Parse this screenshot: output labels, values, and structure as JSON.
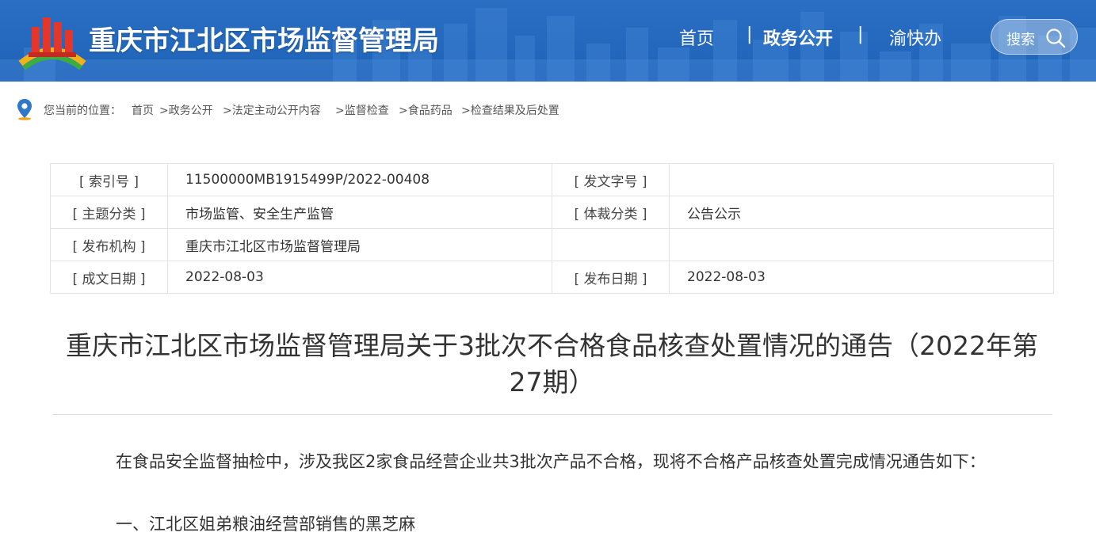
{
  "header": {
    "site_title": "重庆市江北区市场监督管理局",
    "nav": {
      "home": "首页",
      "separator": "|",
      "gov_open": "政务公开",
      "yu_kuai_ban": "渝快办"
    },
    "search_label": "搜索",
    "colors": {
      "bar": "#1f63b8",
      "text": "#ffffff"
    }
  },
  "breadcrumb": {
    "prefix": "您当前的位置：",
    "items": [
      "首页",
      ">政务公开",
      ">法定主动公开内容",
      ">监督检查",
      ">食品药品",
      ">检查结果及后处置"
    ]
  },
  "meta": {
    "rows": [
      {
        "label1": "[ 索引号 ]",
        "value1": "11500000MB1915499P/2022-00408",
        "label2": "[ 发文字号 ]",
        "value2": ""
      },
      {
        "label1": "[ 主题分类 ]",
        "value1": "市场监管、安全生产监管",
        "label2": "[ 体裁分类 ]",
        "value2": "公告公示"
      },
      {
        "label1": "[ 发布机构 ]",
        "value1": "重庆市江北区市场监督管理局",
        "label2": "",
        "value2": ""
      },
      {
        "label1": "[ 成文日期 ]",
        "value1": "2022-08-03",
        "label2": "[ 发布日期 ]",
        "value2": "2022-08-03"
      }
    ]
  },
  "article": {
    "title": "重庆市江北区市场监督管理局关于3批次不合格食品核查处置情况的通告（2022年第27期）",
    "paragraphs": [
      "在食品安全监督抽检中，涉及我区2家食品经营企业共3批次产品不合格，现将不合格产品核查处置完成情况通告如下：",
      "一、江北区姐弟粮油经营部销售的黑芝麻"
    ]
  }
}
